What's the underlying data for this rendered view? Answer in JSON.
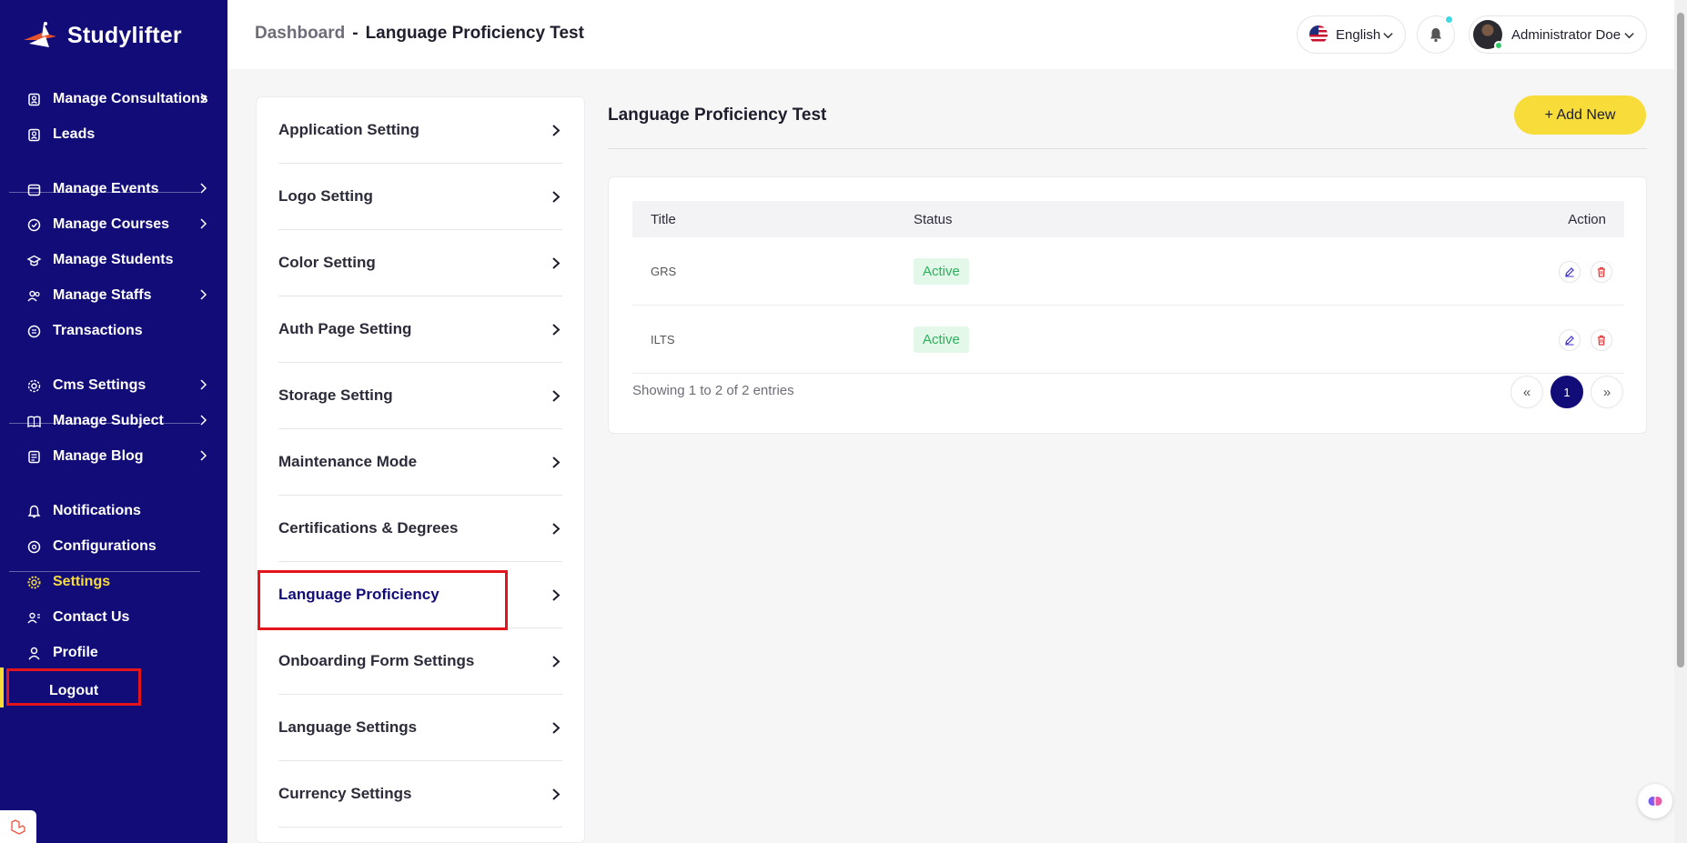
{
  "brand": {
    "name": "Studylifter",
    "logo_icon": "rocket-logo"
  },
  "sidebar": {
    "items": [
      {
        "label": "Manage Consultations",
        "icon": "consultation-icon",
        "has_submenu": true
      },
      {
        "label": "Leads",
        "icon": "leads-icon",
        "has_submenu": false
      },
      {
        "label": "Manage Events",
        "icon": "calendar-icon",
        "has_submenu": true
      },
      {
        "label": "Manage Courses",
        "icon": "courses-icon",
        "has_submenu": true
      },
      {
        "label": "Manage Students",
        "icon": "students-icon",
        "has_submenu": false
      },
      {
        "label": "Manage Staffs",
        "icon": "staff-icon",
        "has_submenu": true
      },
      {
        "label": "Transactions",
        "icon": "transactions-icon",
        "has_submenu": false
      },
      {
        "label": "Cms Settings",
        "icon": "cms-icon",
        "has_submenu": true
      },
      {
        "label": "Manage Subject",
        "icon": "book-icon",
        "has_submenu": true
      },
      {
        "label": "Manage Blog",
        "icon": "blog-icon",
        "has_submenu": true
      },
      {
        "label": "Notifications",
        "icon": "bell-icon",
        "has_submenu": false
      },
      {
        "label": "Configurations",
        "icon": "config-icon",
        "has_submenu": false
      },
      {
        "label": "Settings",
        "icon": "gear-icon",
        "has_submenu": false,
        "active": true
      },
      {
        "label": "Contact Us",
        "icon": "contact-icon",
        "has_submenu": false
      },
      {
        "label": "Profile",
        "icon": "user-icon",
        "has_submenu": false
      },
      {
        "label": "Logout",
        "icon": "logout-icon",
        "has_submenu": false
      }
    ]
  },
  "header": {
    "breadcrumb_root": "Dashboard",
    "breadcrumb_sep": "-",
    "breadcrumb_current": "Language Proficiency Test",
    "language": "English",
    "user_name": "Administrator Doe"
  },
  "settings_menu": {
    "items": [
      {
        "label": "Application Setting"
      },
      {
        "label": "Logo Setting"
      },
      {
        "label": "Color Setting"
      },
      {
        "label": "Auth Page Setting"
      },
      {
        "label": "Storage Setting"
      },
      {
        "label": "Maintenance Mode"
      },
      {
        "label": "Certifications & Degrees"
      },
      {
        "label": "Language Proficiency",
        "active": true
      },
      {
        "label": "Onboarding Form Settings"
      },
      {
        "label": "Language Settings"
      },
      {
        "label": "Currency Settings"
      }
    ]
  },
  "main": {
    "title": "Language Proficiency Test",
    "add_button": "+ Add New",
    "table": {
      "headers": {
        "title": "Title",
        "status": "Status",
        "action": "Action"
      },
      "rows": [
        {
          "title": "GRS",
          "status": "Active"
        },
        {
          "title": "ILTS",
          "status": "Active"
        }
      ]
    },
    "showing": "Showing 1 to 2 of 2 entries",
    "pagination": {
      "prev": "«",
      "current": "1",
      "next": "»"
    }
  },
  "colors": {
    "sidebar_bg": "#120c78",
    "accent_yellow": "#f7dc3a",
    "active_badge_bg": "#e4f8ea",
    "active_badge_text": "#27b35a",
    "highlight_red": "#e3141b"
  }
}
